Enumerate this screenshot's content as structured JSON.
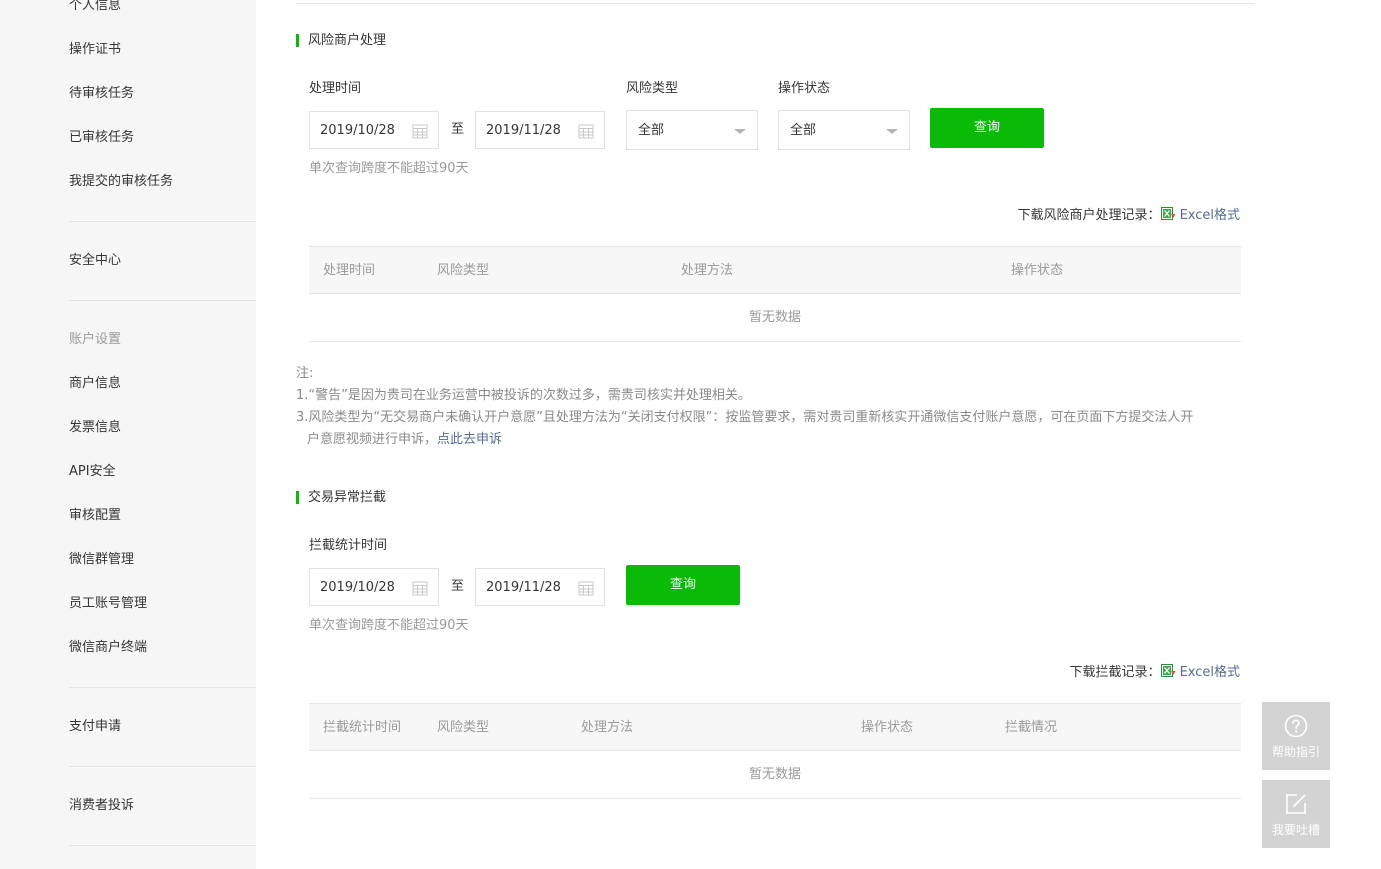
{
  "sidebar": {
    "items_top": [
      "个人信息",
      "操作证书",
      "待审核任务",
      "已审核任务",
      "我提交的审核任务"
    ],
    "security_center": "安全中心",
    "account_settings_label": "账户设置",
    "account_items": [
      "商户信息",
      "发票信息",
      "API安全",
      "审核配置",
      "微信群管理",
      "员工账号管理",
      "微信商户终端"
    ],
    "pay_apply": "支付申请",
    "consumer_complaint": "消费者投诉"
  },
  "risk": {
    "title": "风险商户处理",
    "time_label": "处理时间",
    "start_date": "2019/10/28",
    "to": "至",
    "end_date": "2019/11/28",
    "risk_type_label": "风险类型",
    "risk_type_value": "全部",
    "op_status_label": "操作状态",
    "op_status_value": "全部",
    "query_button": "查询",
    "hint": "单次查询跨度不能超过90天",
    "download_label": "下载风险商户处理记录：",
    "download_link": "Excel格式",
    "columns": [
      "处理时间",
      "风险类型",
      "处理方法",
      "操作状态"
    ],
    "empty": "暂无数据"
  },
  "notes": {
    "heading": "注:",
    "line1": "1.“警告”是因为贵司在业务运营中被投诉的次数过多，需贵司核实并处理相关。",
    "line3a": "3.风险类型为“无交易商户未确认开户意愿”且处理方法为“关闭支付权限”：按监管要求，需对贵司重新核实开通微信支付账户意愿，可在页面下方提交法人开",
    "line3b": "户意愿视频进行申诉，",
    "line3_link": "点此去申诉"
  },
  "intercept": {
    "title": "交易异常拦截",
    "time_label": "拦截统计时间",
    "start_date": "2019/10/28",
    "to": "至",
    "end_date": "2019/11/28",
    "query_button": "查询",
    "hint": "单次查询跨度不能超过90天",
    "download_label": "下载拦截记录：",
    "download_link": "Excel格式",
    "columns": [
      "拦截统计时间",
      "风险类型",
      "处理方法",
      "操作状态",
      "拦截情况"
    ],
    "empty": "暂无数据"
  },
  "float": {
    "help": "帮助指引",
    "feedback": "我要吐槽"
  },
  "colors": {
    "accent_green": "#09bb07",
    "link_blue": "#576b95"
  },
  "icons": [
    "calendar-icon",
    "caret-down-icon",
    "excel-icon",
    "question-icon",
    "edit-icon"
  ]
}
